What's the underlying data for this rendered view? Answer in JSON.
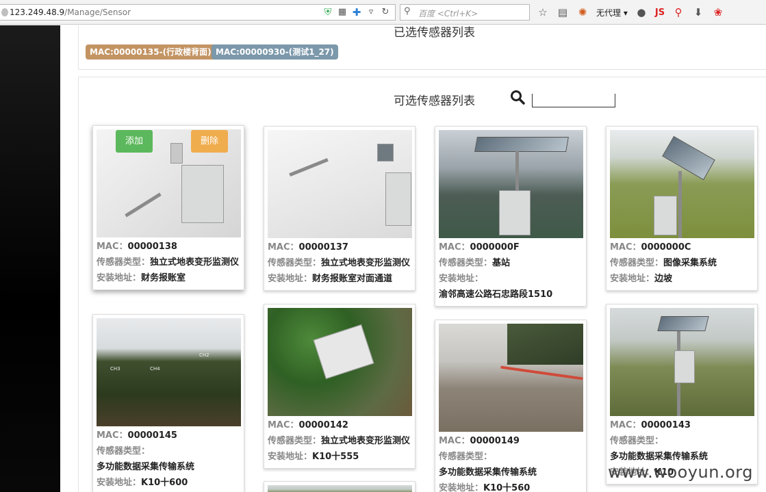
{
  "browser": {
    "url_host": "123.249.48.9",
    "url_path": "/Manage/Sensor",
    "search_placeholder": "百度 <Ctrl+K>",
    "proxy_label": "无代理",
    "js_label": "JS"
  },
  "selected": {
    "title": "已选传感器列表",
    "tags": [
      {
        "label": "MAC:00000135-(行政楼背面)"
      },
      {
        "label": "MAC:00000930-(测试1_27)"
      }
    ]
  },
  "available": {
    "title": "可选传感器列表",
    "search_value": ""
  },
  "labels": {
    "mac": "MAC：",
    "type": "传感器类型：",
    "addr": "安装地址：",
    "add": "添加",
    "delete": "删除"
  },
  "cards": [
    {
      "mac": "00000138",
      "type": "独立式地表变形监测仪",
      "addr": "财务报账室"
    },
    {
      "mac": "00000137",
      "type": "独立式地表变形监测仪",
      "addr": "财务报账室对面通道"
    },
    {
      "mac": "0000000F",
      "type": "基站",
      "addr": "渝邻高速公路石忠路段1510"
    },
    {
      "mac": "0000000C",
      "type": "图像采集系统",
      "addr": "边坡"
    },
    {
      "mac": "00000145",
      "type": "多功能数据采集传输系统",
      "addr": "K10十600"
    },
    {
      "mac": "00000142",
      "type": "独立式地表变形监测仪",
      "addr": "K10十555"
    },
    {
      "mac": "00000149",
      "type": "多功能数据采集传输系统",
      "addr": "K10十560"
    },
    {
      "mac": "00000143",
      "type": "多功能数据采集传输系统",
      "addr": "K10"
    }
  ],
  "photo_labels": {
    "ch3": "CH3",
    "ch4": "CH4",
    "ch2": "CH2"
  },
  "watermark": "www.wooyun.org"
}
